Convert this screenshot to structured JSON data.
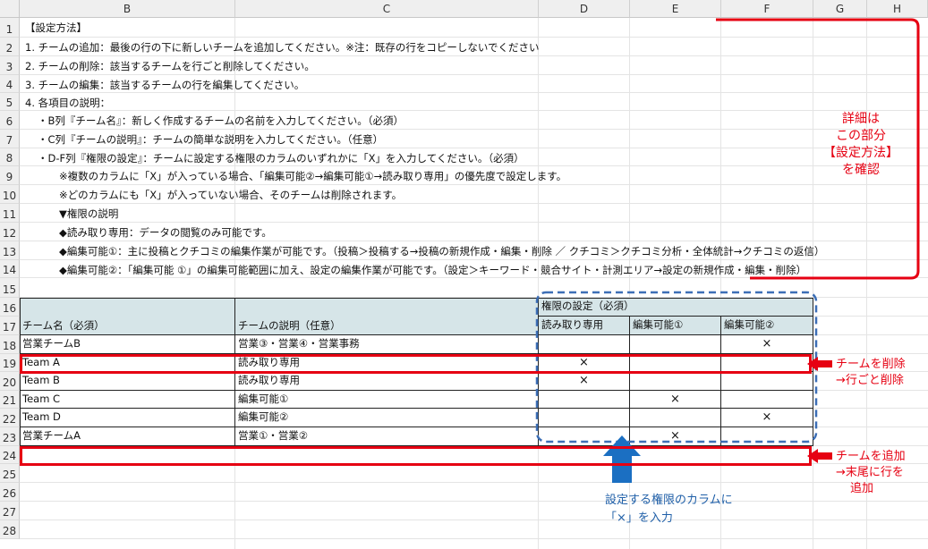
{
  "columns": [
    "B",
    "C",
    "D",
    "E",
    "F",
    "G",
    "H"
  ],
  "rows": [
    "1",
    "2",
    "3",
    "4",
    "5",
    "6",
    "7",
    "8",
    "9",
    "10",
    "11",
    "12",
    "13",
    "14",
    "15",
    "16",
    "17",
    "18",
    "19",
    "20",
    "21",
    "22",
    "23",
    "24",
    "25",
    "26",
    "27",
    "28"
  ],
  "instructions": [
    "【設定方法】",
    "1. チームの追加：最後の行の下に新しいチームを追加してください。※注：既存の行をコピーしないでください",
    "2. チームの削除：該当するチームを行ごと削除してください。",
    "3. チームの編集：該当するチームの行を編集してください。",
    "4. 各項目の説明：",
    "・B列『チーム名』：新しく作成するチームの名前を入力してください。（必須）",
    "・C列『チームの説明』：チームの簡単な説明を入力してください。（任意）",
    "・D-F列『権限の設定』：チームに設定する権限のカラムのいずれかに「X」を入力してください。（必須）",
    "※複数のカラムに「X」が入っている場合、「編集可能②→編集可能①→読み取り専用」の優先度で設定します。",
    "※どのカラムにも「X」が入っていない場合、そのチームは削除されます。",
    "▼権限の説明",
    "◆読み取り専用：データの閲覧のみ可能です。",
    "◆編集可能①：主に投稿とクチコミの編集作業が可能です。（投稿＞投稿する→投稿の新規作成・編集・削除 ／ クチコミ＞クチコミ分析・全体統計→クチコミの返信）",
    "◆編集可能②：「編集可能 ①」の編集可能範囲に加え、設定の編集作業が可能です。（設定＞キーワード・競合サイト・計測エリア→設定の新規作成・編集・削除）"
  ],
  "table": {
    "header_name": "チーム名（必須）",
    "header_desc": "チームの説明（任意）",
    "header_perm_group": "権限の設定（必須）",
    "perm_columns": [
      "読み取り専用",
      "編集可能①",
      "編集可能②"
    ],
    "rows": [
      {
        "name": "営業チームB",
        "desc": "営業③・営業④・営業事務",
        "marks": [
          "",
          "",
          "×"
        ]
      },
      {
        "name": "Team A",
        "desc": "読み取り専用",
        "marks": [
          "×",
          "",
          ""
        ]
      },
      {
        "name": "Team B",
        "desc": "読み取り専用",
        "marks": [
          "×",
          "",
          ""
        ]
      },
      {
        "name": "Team C",
        "desc": "編集可能①",
        "marks": [
          "",
          "×",
          ""
        ]
      },
      {
        "name": "Team D",
        "desc": "編集可能②",
        "marks": [
          "",
          "",
          "×"
        ]
      },
      {
        "name": "営業チームA",
        "desc": "営業①・営業②",
        "marks": [
          "",
          "×",
          ""
        ]
      }
    ]
  },
  "annotations": {
    "detail": [
      "詳細は",
      "この部分",
      "【設定方法】",
      "を確認"
    ],
    "delete": [
      "チームを削除",
      "→行ごと削除"
    ],
    "add": [
      "チームを追加",
      "→末尾に行を",
      "追加"
    ],
    "column_hint": [
      "設定する権限のカラムに",
      "「×」を入力"
    ]
  },
  "colors": {
    "red": "#e60012",
    "blue": "#1f5fa8",
    "header_fill": "#d6e5e8"
  }
}
